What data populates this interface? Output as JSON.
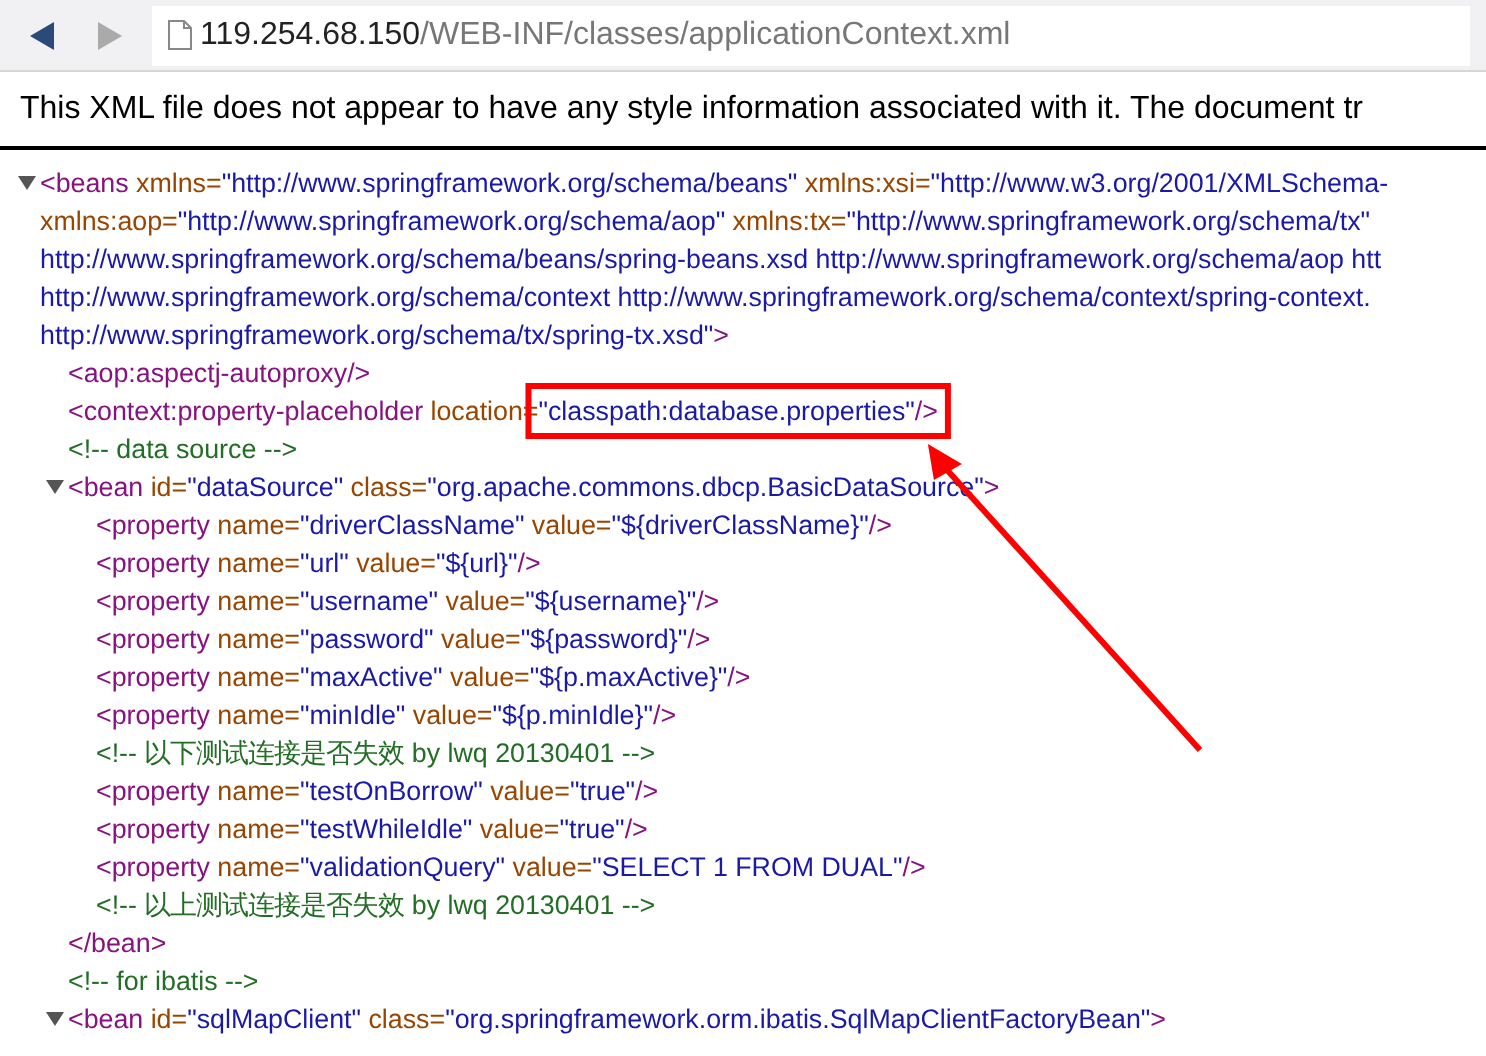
{
  "toolbar": {
    "back_disabled": false,
    "forward_disabled": true,
    "url_host": "119.254.68.150",
    "url_path": "/WEB-INF/classes/applicationContext.xml"
  },
  "info": "This XML file does not appear to have any style information associated with it. The document tr",
  "tree": {
    "expanded": true,
    "lines": [
      [
        {
          "kind": "tag",
          "t": "<beans"
        },
        {
          "kind": "attr",
          "t": " xmlns="
        },
        {
          "kind": "val",
          "t": "\"http://www.springframework.org/schema/beans\""
        },
        {
          "kind": "attr",
          "t": " xmlns:xsi="
        },
        {
          "kind": "val",
          "t": "\"http://www.w3.org/2001/XMLSchema-"
        }
      ],
      [
        {
          "kind": "attr",
          "t": "xmlns:aop="
        },
        {
          "kind": "val",
          "t": "\"http://www.springframework.org/schema/aop\""
        },
        {
          "kind": "attr",
          "t": " xmlns:tx="
        },
        {
          "kind": "val",
          "t": "\"http://www.springframework.org/schema/tx\""
        }
      ],
      [
        {
          "kind": "val",
          "t": "http://www.springframework.org/schema/beans/spring-beans.xsd http://www.springframework.org/schema/aop htt"
        }
      ],
      [
        {
          "kind": "val",
          "t": "http://www.springframework.org/schema/context http://www.springframework.org/schema/context/spring-context."
        }
      ],
      [
        {
          "kind": "val",
          "t": "http://www.springframework.org/schema/tx/spring-tx.xsd\""
        },
        {
          "kind": "tag",
          "t": ">"
        }
      ]
    ],
    "children": [
      {
        "lines": [
          [
            {
              "kind": "tag",
              "t": "<aop:aspectj-autoproxy/>"
            }
          ]
        ]
      },
      {
        "lines": [
          [
            {
              "kind": "tag",
              "t": "<context:property-placeholder"
            },
            {
              "kind": "attr",
              "t": " location="
            },
            {
              "kind": "val",
              "t": "\"classpath:database.properties\"",
              "highlighted": true
            },
            {
              "kind": "tag",
              "t": "/>"
            }
          ]
        ]
      },
      {
        "lines": [
          [
            {
              "kind": "cm",
              "t": "<!--  data source  -->"
            }
          ]
        ]
      },
      {
        "expanded": true,
        "lines": [
          [
            {
              "kind": "tag",
              "t": "<bean"
            },
            {
              "kind": "attr",
              "t": " id="
            },
            {
              "kind": "val",
              "t": "\"dataSource\""
            },
            {
              "kind": "attr",
              "t": " class="
            },
            {
              "kind": "val",
              "t": "\"org.apache.commons.dbcp.BasicDataSource\""
            },
            {
              "kind": "tag",
              "t": ">"
            }
          ]
        ],
        "children": [
          {
            "lines": [
              [
                {
                  "kind": "tag",
                  "t": "<property"
                },
                {
                  "kind": "attr",
                  "t": " name="
                },
                {
                  "kind": "val",
                  "t": "\"driverClassName\""
                },
                {
                  "kind": "attr",
                  "t": " value="
                },
                {
                  "kind": "val",
                  "t": "\"${driverClassName}\""
                },
                {
                  "kind": "tag",
                  "t": "/>"
                }
              ]
            ]
          },
          {
            "lines": [
              [
                {
                  "kind": "tag",
                  "t": "<property"
                },
                {
                  "kind": "attr",
                  "t": " name="
                },
                {
                  "kind": "val",
                  "t": "\"url\""
                },
                {
                  "kind": "attr",
                  "t": " value="
                },
                {
                  "kind": "val",
                  "t": "\"${url}\""
                },
                {
                  "kind": "tag",
                  "t": "/>"
                }
              ]
            ]
          },
          {
            "lines": [
              [
                {
                  "kind": "tag",
                  "t": "<property"
                },
                {
                  "kind": "attr",
                  "t": " name="
                },
                {
                  "kind": "val",
                  "t": "\"username\""
                },
                {
                  "kind": "attr",
                  "t": " value="
                },
                {
                  "kind": "val",
                  "t": "\"${username}\""
                },
                {
                  "kind": "tag",
                  "t": "/>"
                }
              ]
            ]
          },
          {
            "lines": [
              [
                {
                  "kind": "tag",
                  "t": "<property"
                },
                {
                  "kind": "attr",
                  "t": " name="
                },
                {
                  "kind": "val",
                  "t": "\"password\""
                },
                {
                  "kind": "attr",
                  "t": " value="
                },
                {
                  "kind": "val",
                  "t": "\"${password}\""
                },
                {
                  "kind": "tag",
                  "t": "/>"
                }
              ]
            ]
          },
          {
            "lines": [
              [
                {
                  "kind": "tag",
                  "t": "<property"
                },
                {
                  "kind": "attr",
                  "t": " name="
                },
                {
                  "kind": "val",
                  "t": "\"maxActive\""
                },
                {
                  "kind": "attr",
                  "t": " value="
                },
                {
                  "kind": "val",
                  "t": "\"${p.maxActive}\""
                },
                {
                  "kind": "tag",
                  "t": "/>"
                }
              ]
            ]
          },
          {
            "lines": [
              [
                {
                  "kind": "tag",
                  "t": "<property"
                },
                {
                  "kind": "attr",
                  "t": " name="
                },
                {
                  "kind": "val",
                  "t": "\"minIdle\""
                },
                {
                  "kind": "attr",
                  "t": " value="
                },
                {
                  "kind": "val",
                  "t": "\"${p.minIdle}\""
                },
                {
                  "kind": "tag",
                  "t": "/>"
                }
              ]
            ]
          },
          {
            "lines": [
              [
                {
                  "kind": "cm",
                  "t": "<!--  以下测试连接是否失效 by lwq 20130401  -->"
                }
              ]
            ]
          },
          {
            "lines": [
              [
                {
                  "kind": "tag",
                  "t": "<property"
                },
                {
                  "kind": "attr",
                  "t": " name="
                },
                {
                  "kind": "val",
                  "t": "\"testOnBorrow\""
                },
                {
                  "kind": "attr",
                  "t": " value="
                },
                {
                  "kind": "val",
                  "t": "\"true\""
                },
                {
                  "kind": "tag",
                  "t": "/>"
                }
              ]
            ]
          },
          {
            "lines": [
              [
                {
                  "kind": "tag",
                  "t": "<property"
                },
                {
                  "kind": "attr",
                  "t": " name="
                },
                {
                  "kind": "val",
                  "t": "\"testWhileIdle\""
                },
                {
                  "kind": "attr",
                  "t": " value="
                },
                {
                  "kind": "val",
                  "t": "\"true\""
                },
                {
                  "kind": "tag",
                  "t": "/>"
                }
              ]
            ]
          },
          {
            "lines": [
              [
                {
                  "kind": "tag",
                  "t": "<property"
                },
                {
                  "kind": "attr",
                  "t": " name="
                },
                {
                  "kind": "val",
                  "t": "\"validationQuery\""
                },
                {
                  "kind": "attr",
                  "t": " value="
                },
                {
                  "kind": "val",
                  "t": "\"SELECT 1 FROM DUAL\""
                },
                {
                  "kind": "tag",
                  "t": "/>"
                }
              ]
            ]
          },
          {
            "lines": [
              [
                {
                  "kind": "cm",
                  "t": "<!--  以上测试连接是否失效 by lwq 20130401  -->"
                }
              ]
            ]
          }
        ],
        "close": [
          {
            "kind": "tag",
            "t": "</bean>"
          }
        ]
      },
      {
        "lines": [
          [
            {
              "kind": "cm",
              "t": "<!--  for ibatis  -->"
            }
          ]
        ]
      },
      {
        "expanded": true,
        "lines": [
          [
            {
              "kind": "tag",
              "t": "<bean"
            },
            {
              "kind": "attr",
              "t": " id="
            },
            {
              "kind": "val",
              "t": "\"sqlMapClient\""
            },
            {
              "kind": "attr",
              "t": " class="
            },
            {
              "kind": "val",
              "t": "\"org.springframework.orm.ibatis.SqlMapClientFactoryBean\""
            },
            {
              "kind": "tag",
              "t": ">"
            }
          ]
        ]
      }
    ]
  }
}
